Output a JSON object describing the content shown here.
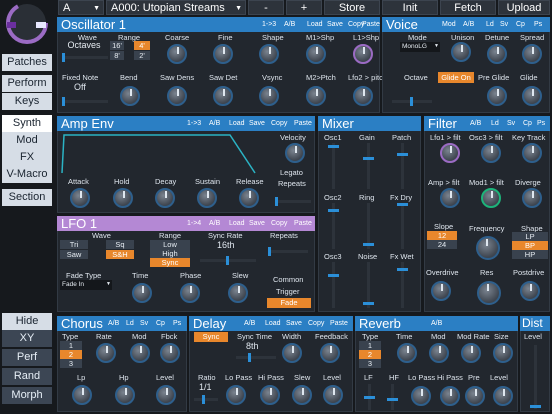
{
  "topbar": {
    "bank": "A",
    "patch": "A000: Utopian Streams",
    "minus": "-",
    "plus": "+",
    "store": "Store",
    "init": "Init",
    "fetch": "Fetch",
    "upload": "Upload"
  },
  "sidebar": {
    "patches": "Patches",
    "perform": "Perform",
    "keys": "Keys",
    "synth": "Synth",
    "mod": "Mod",
    "fx": "FX",
    "vmacro": "V-Macro",
    "section": "Section",
    "hide": "Hide",
    "xy": "XY",
    "perf": "Perf",
    "rand": "Rand",
    "morph": "Morph"
  },
  "osc": {
    "title": "Oscillator 1",
    "m": [
      "1->3",
      "A/B",
      "Load",
      "Save",
      "Copy",
      "Paste"
    ],
    "row1": [
      "Wave",
      "Range",
      "Coarse",
      "Fine",
      "Shape",
      "M1>Shp",
      "L1>Shp"
    ],
    "wave": "Octaves",
    "range": [
      "16'",
      "4'",
      "8'",
      "2'"
    ],
    "row2": [
      "Fixed Note",
      "Bend",
      "Saw Dens",
      "Saw Det",
      "Vsync",
      "M2>Ptch",
      "Lfo2 > pitch"
    ],
    "fixed": "Off"
  },
  "voice": {
    "title": "Voice",
    "m": [
      "Mod",
      "A/B",
      "Ld",
      "Sv",
      "Cp",
      "Ps"
    ],
    "row1": [
      "Mode",
      "Unison",
      "Detune",
      "Spread"
    ],
    "mode": "MonoLG",
    "row2": [
      "Octave",
      "Glide On",
      "Pre Glide",
      "Glide"
    ]
  },
  "amp": {
    "title": "Amp Env",
    "m": [
      "1->3",
      "A/B",
      "Load",
      "Save",
      "Copy",
      "Paste"
    ],
    "velocity": "Velocity",
    "labels": [
      "Attack",
      "Hold",
      "Decay",
      "Sustain",
      "Release"
    ],
    "legato": "Legato",
    "repeats": "Repeats"
  },
  "mixer": {
    "title": "Mixer",
    "cols": [
      "Osc1",
      "Gain",
      "Patch",
      "Osc2",
      "Ring",
      "Fx Dry",
      "Osc3",
      "Noise",
      "Fx Wet"
    ]
  },
  "filter": {
    "title": "Filter",
    "m": [
      "A/B",
      "Ld",
      "Sv",
      "Cp",
      "Ps"
    ],
    "row1": [
      "Lfo1 > filt",
      "Osc3 > filt",
      "Key Track"
    ],
    "row2": [
      "Amp > filt",
      "Mod1 > filt",
      "Diverge"
    ],
    "slope": "Slope",
    "slopes": [
      "12",
      "24"
    ],
    "frequency": "Frequency",
    "shape": "Shape",
    "shapes": [
      "LP",
      "BP",
      "HP"
    ],
    "row3": [
      "Overdrive",
      "Res",
      "Postdrive"
    ]
  },
  "lfo": {
    "title": "LFO 1",
    "m": [
      "1->4",
      "A/B",
      "Load",
      "Save",
      "Copy",
      "Paste"
    ],
    "wave": "Wave",
    "waves": [
      "Tri",
      "Sq",
      "Saw",
      "S&H"
    ],
    "range": "Range",
    "ranges": [
      "Low",
      "High",
      "Sync"
    ],
    "syncrate": "Sync Rate",
    "syncval": "16th",
    "repeats": "Repeats",
    "fadetype": "Fade Type",
    "fadein": "Fade In",
    "time": "Time",
    "phase": "Phase",
    "slew": "Slew",
    "modes": [
      "Common",
      "Trigger",
      "Fade"
    ]
  },
  "chorus": {
    "title": "Chorus",
    "m": [
      "A/B",
      "Ld",
      "Sv",
      "Cp",
      "Ps"
    ],
    "row1": [
      "Type",
      "Rate",
      "Mod",
      "Fbck"
    ],
    "types": [
      "1",
      "2",
      "3"
    ],
    "row2": [
      "Lp",
      "Hp",
      "Level"
    ]
  },
  "delay": {
    "title": "Delay",
    "m": [
      "A/B",
      "Load",
      "Save",
      "Copy",
      "Paste"
    ],
    "sync": "Sync",
    "synctime": "Sync Time",
    "syncval": "8th",
    "row1": [
      "Width",
      "Feedback"
    ],
    "ratio": "Ratio",
    "ratioval": "1/1",
    "row2": [
      "Lo Pass",
      "Hi Pass",
      "Slew",
      "Level"
    ]
  },
  "reverb": {
    "title": "Reverb",
    "m": [
      "A/B"
    ],
    "row1": [
      "Type",
      "Time",
      "Mod",
      "Mod Rate",
      "Size"
    ],
    "types": [
      "1",
      "2",
      "3"
    ],
    "row2": [
      "LF",
      "HF",
      "Lo Pass",
      "Hi Pass",
      "Pre",
      "Level"
    ]
  },
  "dist": {
    "title": "Dist",
    "level": "Level"
  },
  "colors": {
    "accent": "#2b7fc4",
    "orange": "#e8872c",
    "lfo": "#b488d4"
  }
}
